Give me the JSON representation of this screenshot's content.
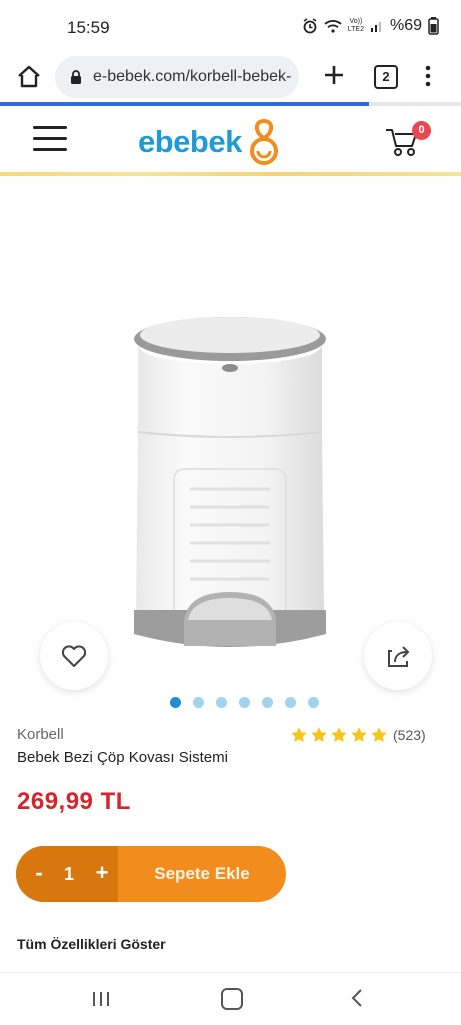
{
  "status_bar": {
    "time": "15:59",
    "network": "Vo))\nLTE2",
    "battery": "%69"
  },
  "browser": {
    "url": "e-bebek.com/korbell-bebek-",
    "tab_count": "2",
    "load_progress": 0.8
  },
  "header": {
    "logo_text": "ebebek",
    "cart_count": "0"
  },
  "product": {
    "brand": "Korbell",
    "title": "Bebek Bezi Çöp Kovası Sistemi",
    "rating_stars": 5,
    "review_count": "(523)",
    "price": "269,99 TL",
    "image_count": 7,
    "active_image_index": 0
  },
  "cart_control": {
    "minus_label": "-",
    "quantity": "1",
    "plus_label": "+",
    "add_label": "Sepete Ekle"
  },
  "features_link": "Tüm Özellikleri Göster",
  "colors": {
    "brand_blue": "#1e9bd7",
    "logo_orange": "#f28c1c",
    "price_red": "#d8232a",
    "star_yellow": "#f5c518",
    "cta_orange": "#f28c1c",
    "cta_dark": "#d9770f"
  }
}
